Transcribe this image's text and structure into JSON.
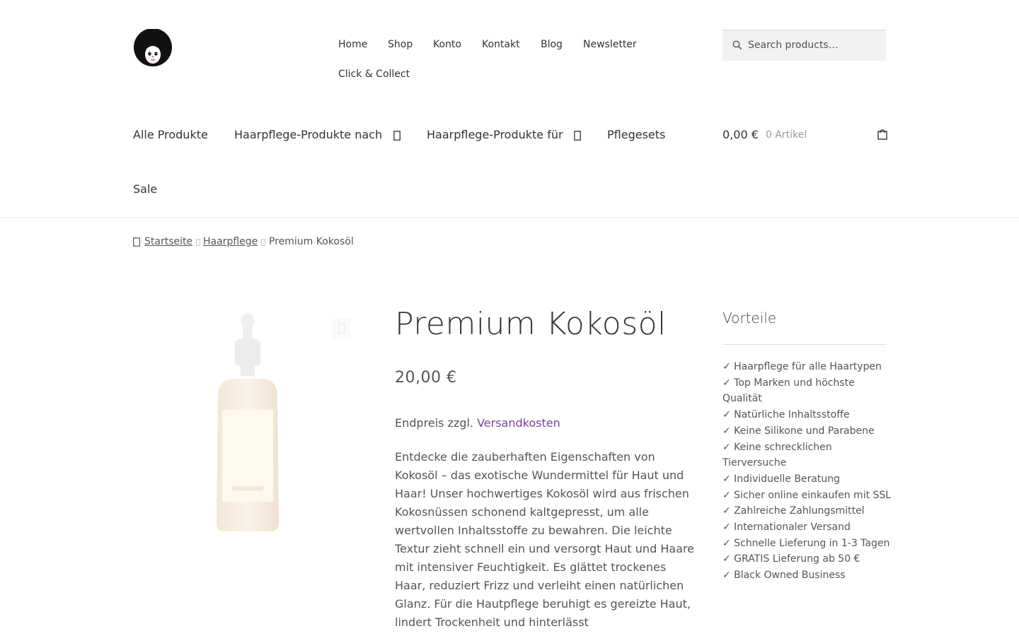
{
  "header": {
    "top_nav": [
      {
        "label": "Home"
      },
      {
        "label": "Shop"
      },
      {
        "label": "Konto"
      },
      {
        "label": "Kontakt"
      },
      {
        "label": "Blog"
      },
      {
        "label": "Newsletter"
      },
      {
        "label": "Click & Collect"
      }
    ],
    "search": {
      "placeholder": "Search products…"
    },
    "main_nav": [
      {
        "label": "Alle Produkte"
      },
      {
        "label": "Haarpflege-Produkte nach"
      },
      {
        "label": "Haarpflege-Produkte für"
      },
      {
        "label": "Pflegesets"
      },
      {
        "label": "Sale"
      }
    ],
    "cart": {
      "total": "0,00 €",
      "count": "0 Artikel"
    }
  },
  "breadcrumb": {
    "items": [
      {
        "label": "Startseite"
      },
      {
        "label": "Haarpflege"
      },
      {
        "label": "Premium Kokosöl"
      }
    ]
  },
  "product": {
    "title": "Premium Kokosöl",
    "price": "20,00 €",
    "tax_prefix": "Endpreis zzgl.",
    "tax_link": "Versandkosten",
    "description": "Entdecke die zauberhaften Eigenschaften von Kokosöl – das exotische Wundermittel für Haut und Haar! Unser hochwertiges Kokosöl wird aus frischen Kokosnüssen schonend kaltgepresst, um alle wertvollen Inhaltsstoffe zu bewahren. Die leichte Textur zieht schnell ein und versorgt Haut und Haare mit intensiver Feuchtigkeit. Es glättet trockenes Haar, reduziert Frizz und verleiht einen natürlichen Glanz. Für die Hautpflege beruhigt es gereizte Haut, lindert Trockenheit und hinterlässt"
  },
  "sidebar": {
    "title": "Vorteile",
    "benefits": [
      "✓ Haarpflege für alle Haartypen",
      "✓ Top Marken und höchste Qualität",
      "✓ Natürliche Inhaltsstoffe",
      "✓ Keine Silikone und Parabene",
      "✓ Keine schrecklichen Tierversuche",
      "✓ Individuelle Beratung",
      "✓ Sicher online einkaufen mit SSL",
      "✓ Zahlreiche Zahlungsmittel",
      "✓ Internationaler Versand",
      "✓ Schnelle Lieferung in 1-3 Tagen",
      "✓ GRATIS Lieferung ab 50 €",
      "✓ Black Owned Business"
    ]
  },
  "colors": {
    "link_accent": "#7a3e9d",
    "search_bg": "#f2f2f2",
    "text": "#555555"
  },
  "icons": {
    "logo": "afro-face-logo",
    "search": "search-icon",
    "cart": "shopping-bag-icon",
    "home": "home-icon",
    "zoom": "magnifier-zoom-icon"
  }
}
